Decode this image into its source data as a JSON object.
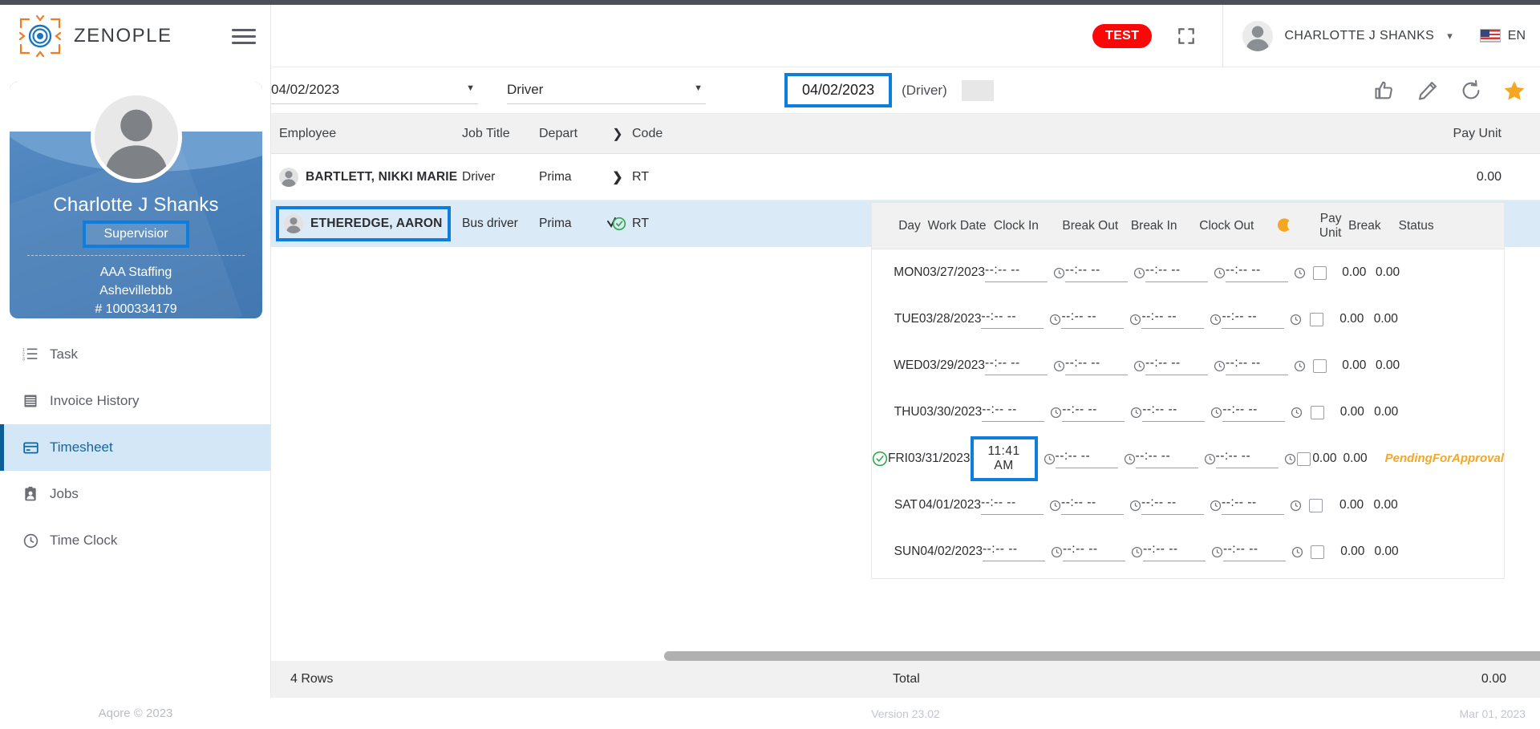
{
  "brand": {
    "name": "ZENOPLE"
  },
  "profile": {
    "name": "Charlotte J Shanks",
    "role": "Supervisior",
    "company": "AAA Staffing",
    "location": "Ashevillebbb",
    "id": "# 1000334179"
  },
  "sidebar": {
    "items": [
      {
        "label": "Task",
        "icon": "ordered-list-icon"
      },
      {
        "label": "Invoice History",
        "icon": "invoice-icon"
      },
      {
        "label": "Timesheet",
        "icon": "timesheet-card-icon"
      },
      {
        "label": "Jobs",
        "icon": "jobs-badge-icon"
      },
      {
        "label": "Time Clock",
        "icon": "clock-icon"
      }
    ],
    "active_index": 2,
    "footer": "Aqore © 2023"
  },
  "header": {
    "test_badge": "TEST",
    "expand_icon": "fullscreen-icon",
    "user_name": "CHARLOTTE J SHANKS",
    "caret": "chevron-down-icon",
    "language": "EN",
    "flag": "us-flag-icon"
  },
  "toolbar": {
    "date_filter": "04/02/2023",
    "role_filter": "Driver",
    "selected_date": "04/02/2023",
    "selected_role": "(Driver)",
    "actions": [
      {
        "name": "thumbs-up-icon",
        "label": "Approve"
      },
      {
        "name": "pencil-icon",
        "label": "Edit"
      },
      {
        "name": "refresh-icon",
        "label": "Refresh"
      },
      {
        "name": "star-icon",
        "label": "Favorite"
      }
    ]
  },
  "employee_table": {
    "columns": [
      "Employee",
      "Job Title",
      "Depart",
      "Code",
      "Pay Unit"
    ],
    "rows": [
      {
        "name": "BARTLETT, NIKKI MARIE",
        "job_title": "Driver",
        "department": "Prima",
        "expander": "chevron-right-icon",
        "code": "RT",
        "pay_unit": "0.00",
        "selected": false
      },
      {
        "name": "ETHEREDGE, AARON",
        "job_title": "Bus driver",
        "department": "Prima",
        "expander": "check-circle-icon",
        "code": "RT",
        "pay_unit": "0.00",
        "selected": true
      }
    ]
  },
  "timesheet_grid": {
    "columns": [
      "Day",
      "Work Date",
      "Clock In",
      "Break Out",
      "Break In",
      "Clock Out",
      "",
      "Pay Unit",
      "Break",
      "Status"
    ],
    "night_icon": "moon-icon",
    "empty_time": "--:-- --",
    "rows": [
      {
        "day": "MON",
        "work_date": "03/27/2023",
        "clock_in": "--:-- --",
        "break_out": "--:-- --",
        "break_in": "--:-- --",
        "clock_out": "--:-- --",
        "pay_unit": "0.00",
        "break": "0.00",
        "status": "",
        "approved": false,
        "focused": false
      },
      {
        "day": "TUE",
        "work_date": "03/28/2023",
        "clock_in": "--:-- --",
        "break_out": "--:-- --",
        "break_in": "--:-- --",
        "clock_out": "--:-- --",
        "pay_unit": "0.00",
        "break": "0.00",
        "status": "",
        "approved": false,
        "focused": false
      },
      {
        "day": "WED",
        "work_date": "03/29/2023",
        "clock_in": "--:-- --",
        "break_out": "--:-- --",
        "break_in": "--:-- --",
        "clock_out": "--:-- --",
        "pay_unit": "0.00",
        "break": "0.00",
        "status": "",
        "approved": false,
        "focused": false
      },
      {
        "day": "THU",
        "work_date": "03/30/2023",
        "clock_in": "--:-- --",
        "break_out": "--:-- --",
        "break_in": "--:-- --",
        "clock_out": "--:-- --",
        "pay_unit": "0.00",
        "break": "0.00",
        "status": "",
        "approved": false,
        "focused": false
      },
      {
        "day": "FRI",
        "work_date": "03/31/2023",
        "clock_in": "11:41 AM",
        "break_out": "--:-- --",
        "break_in": "--:-- --",
        "clock_out": "--:-- --",
        "pay_unit": "0.00",
        "break": "0.00",
        "status": "PendingForApproval",
        "approved": true,
        "focused": true
      },
      {
        "day": "SAT",
        "work_date": "04/01/2023",
        "clock_in": "--:-- --",
        "break_out": "--:-- --",
        "break_in": "--:-- --",
        "clock_out": "--:-- --",
        "pay_unit": "0.00",
        "break": "0.00",
        "status": "",
        "approved": false,
        "focused": false
      },
      {
        "day": "SUN",
        "work_date": "04/02/2023",
        "clock_in": "--:-- --",
        "break_out": "--:-- --",
        "break_in": "--:-- --",
        "clock_out": "--:-- --",
        "pay_unit": "0.00",
        "break": "0.00",
        "status": "",
        "approved": false,
        "focused": false
      }
    ]
  },
  "totals": {
    "rows_label": "4 Rows",
    "total_label": "Total",
    "total_value": "0.00"
  },
  "footer": {
    "version": "Version 23.02",
    "date": "Mar 01, 2023"
  },
  "colors": {
    "accent_blue": "#0e7ddb",
    "nav_active_bg": "#d4e7f7",
    "nav_active_text": "#15659e",
    "test_red": "#fb0707",
    "status_orange": "#f5a623",
    "check_green": "#2fa84f",
    "card_blue": "#4b82bb"
  }
}
